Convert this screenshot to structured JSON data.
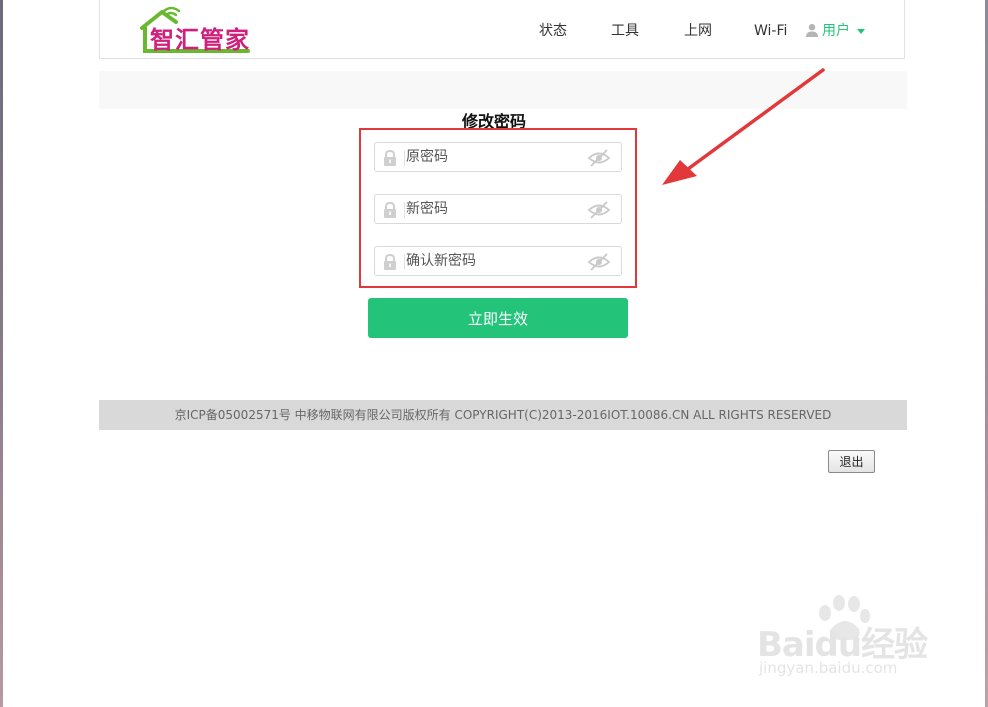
{
  "header": {
    "logo_text": "智汇管家",
    "nav": [
      "状态",
      "工具",
      "上网",
      "Wi-Fi"
    ],
    "user_menu": "用户"
  },
  "form": {
    "title": "修改密码",
    "old_password_placeholder": "原密码",
    "new_password_placeholder": "新密码",
    "confirm_password_placeholder": "确认新密码",
    "submit_label": "立即生效"
  },
  "footer": {
    "copyright": "京ICP备05002571号 中移物联网有限公司版权所有 COPYRIGHT(C)2013-2016IOT.10086.CN ALL RIGHTS RESERVED"
  },
  "logout_label": "退出",
  "watermark": {
    "brand": "Baidu经验",
    "url": "jingyan.baidu.com"
  },
  "colors": {
    "accent": "#23c47a",
    "logo_magenta": "#d0207c",
    "logo_green": "#6ab82f",
    "annotation_red": "#e3383a"
  },
  "icons": {
    "field_left": "lock-icon",
    "field_right": "eye-slash-icon",
    "user": "user-icon"
  }
}
